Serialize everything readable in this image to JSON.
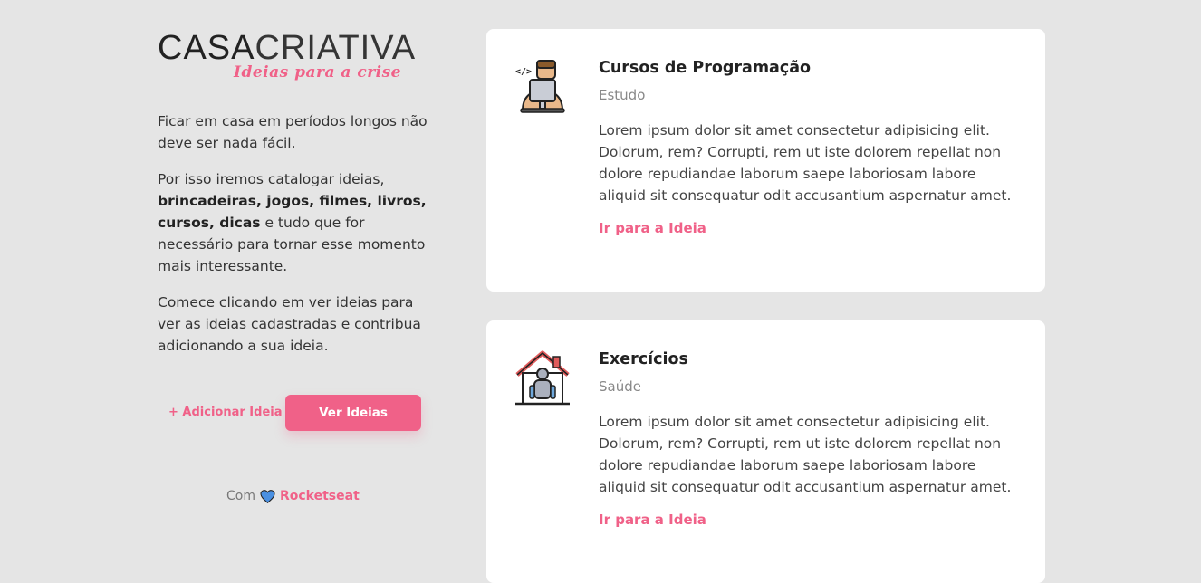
{
  "logo": {
    "bold": "CASA",
    "light": "CRIATIVA",
    "tagline": "Ideias para a crise"
  },
  "intro": {
    "p1": "Ficar em casa em períodos longos não deve ser nada fácil.",
    "p2_pre": "Por isso iremos catalogar ideias, ",
    "p2_bold": "brincadeiras, jogos, filmes, livros, cursos, dicas",
    "p2_post": " e tudo que for necessário para tornar esse momento mais interessante.",
    "p3": "Comece clicando em ver ideias para ver as ideias cadastradas e contribua adicionando a sua ideia."
  },
  "actions": {
    "add_label": "+ Adicionar Ideia",
    "view_label": "Ver Ideias"
  },
  "footer": {
    "prefix": "Com",
    "brand": "Rocketseat",
    "heart_color": "#4a90e2"
  },
  "colors": {
    "accent": "#f06188",
    "background": "#e5e5e5",
    "card": "#ffffff"
  },
  "cards": [
    {
      "icon": "programmer-icon",
      "title": "Cursos de Programação",
      "category": "Estudo",
      "text": "Lorem ipsum dolor sit amet consectetur adipisicing elit. Dolorum, rem? Corrupti, rem ut iste dolorem repellat non dolore repudiandae laborum saepe laboriosam labore aliquid sit consequatur odit accusantium aspernatur amet.",
      "link": "Ir para a Ideia"
    },
    {
      "icon": "home-exercise-icon",
      "title": "Exercícios",
      "category": "Saúde",
      "text": "Lorem ipsum dolor sit amet consectetur adipisicing elit. Dolorum, rem? Corrupti, rem ut iste dolorem repellat non dolore repudiandae laborum saepe laboriosam labore aliquid sit consequatur odit accusantium aspernatur amet.",
      "link": "Ir para a Ideia"
    }
  ]
}
